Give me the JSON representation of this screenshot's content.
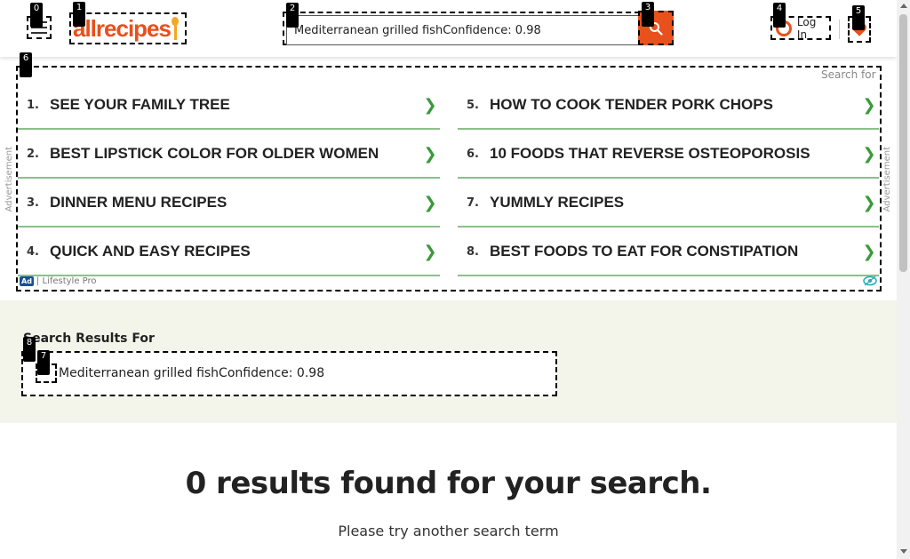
{
  "header": {
    "logo_text": "allrecipes",
    "search_value": "Mediterranean grilled fishConfidence: 0.98",
    "login_label": "Log In"
  },
  "badges": [
    "0",
    "1",
    "2",
    "3",
    "4",
    "5",
    "6",
    "7",
    "8"
  ],
  "ad": {
    "side_label": "Advertisement",
    "search_for": "Search for",
    "left_items": [
      {
        "num": "1.",
        "label": "SEE YOUR FAMILY TREE"
      },
      {
        "num": "2.",
        "label": "BEST LIPSTICK COLOR FOR OLDER WOMEN"
      },
      {
        "num": "3.",
        "label": "DINNER MENU RECIPES"
      },
      {
        "num": "4.",
        "label": "QUICK AND EASY RECIPES"
      }
    ],
    "right_items": [
      {
        "num": "5.",
        "label": "HOW TO COOK TENDER PORK CHOPS"
      },
      {
        "num": "6.",
        "label": "10 FOODS THAT REVERSE OSTEOPOROSIS"
      },
      {
        "num": "7.",
        "label": "YUMMLY RECIPES"
      },
      {
        "num": "8.",
        "label": "BEST FOODS TO EAT FOR CONSTIPATION"
      }
    ],
    "arrow": "❯",
    "ad_tag": "Ad",
    "sponsor": "| Lifestyle Pro"
  },
  "results": {
    "heading": "Search Results For",
    "query": "Mediterranean grilled fishConfidence: 0.98"
  },
  "empty": {
    "title": "0 results found for your search.",
    "subtitle": "Please try another search term"
  },
  "colors": {
    "brand": "#e8501c",
    "ad_green": "#3a9a3a",
    "results_bg": "#f3f4ea"
  }
}
